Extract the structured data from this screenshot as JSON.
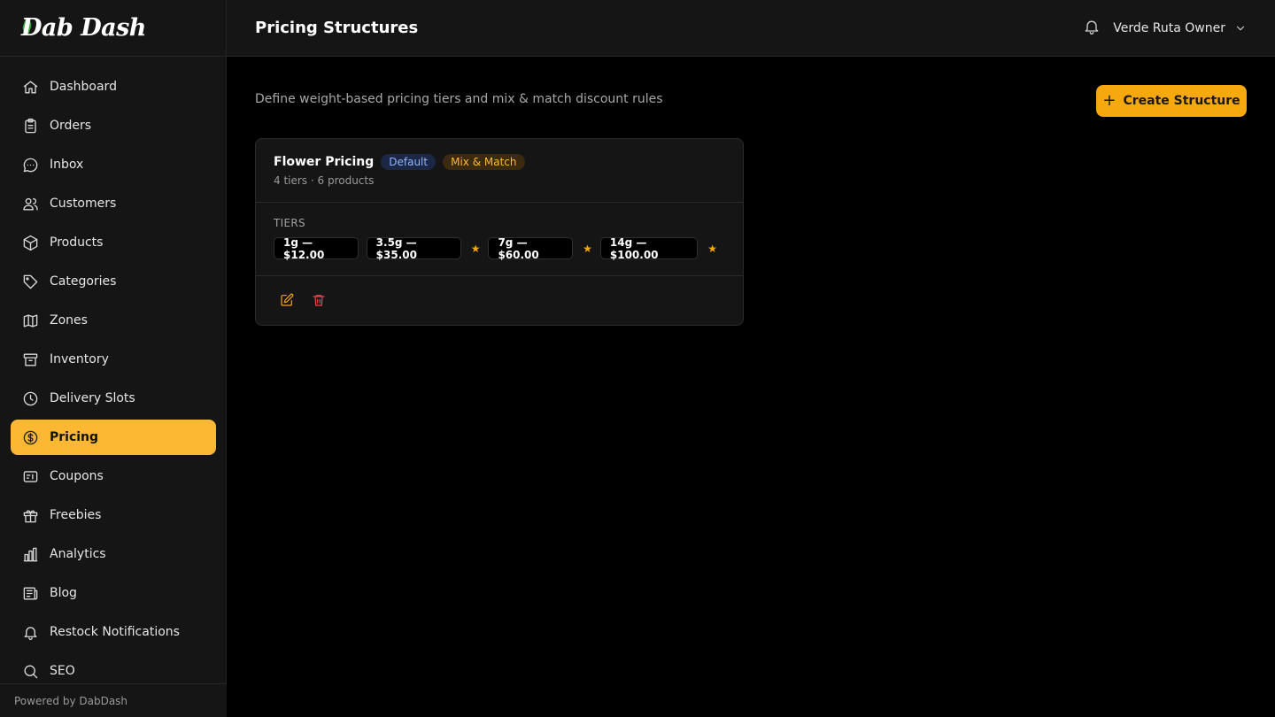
{
  "app": {
    "logo_text": "Dab Dash",
    "footer": "Powered by DabDash"
  },
  "header": {
    "title": "Pricing Structures",
    "user_name": "Verde Ruta Owner"
  },
  "sidebar": {
    "items": [
      {
        "label": "Dashboard",
        "icon": "home-icon"
      },
      {
        "label": "Orders",
        "icon": "clipboard-icon"
      },
      {
        "label": "Inbox",
        "icon": "chat-icon"
      },
      {
        "label": "Customers",
        "icon": "users-icon"
      },
      {
        "label": "Products",
        "icon": "box-icon"
      },
      {
        "label": "Categories",
        "icon": "tag-icon"
      },
      {
        "label": "Zones",
        "icon": "map-icon"
      },
      {
        "label": "Inventory",
        "icon": "archive-icon"
      },
      {
        "label": "Delivery Slots",
        "icon": "clock-icon"
      },
      {
        "label": "Pricing",
        "icon": "dollar-icon",
        "active": true
      },
      {
        "label": "Coupons",
        "icon": "ticket-icon"
      },
      {
        "label": "Freebies",
        "icon": "gift-icon"
      },
      {
        "label": "Analytics",
        "icon": "bar-chart-icon"
      },
      {
        "label": "Blog",
        "icon": "newspaper-icon"
      },
      {
        "label": "Restock Notifications",
        "icon": "bell-icon"
      },
      {
        "label": "SEO",
        "icon": "search-icon"
      }
    ]
  },
  "main": {
    "subtitle": "Define weight-based pricing tiers and mix & match discount rules",
    "create_label": "Create Structure",
    "structure": {
      "name": "Flower Pricing",
      "badges": [
        "Default",
        "Mix & Match"
      ],
      "meta": "4 tiers · 6 products",
      "tiers_label": "TIERS",
      "tiers": [
        "1g — $12.00",
        "3.5g — $35.00",
        "7g — $60.00",
        "14g — $100.00"
      ],
      "tier_marker": "★"
    }
  },
  "colors": {
    "accent": "#f6a80f",
    "active_nav": "#fcb833",
    "delete": "#e5484d",
    "default_badge": "#8eb4ff"
  }
}
